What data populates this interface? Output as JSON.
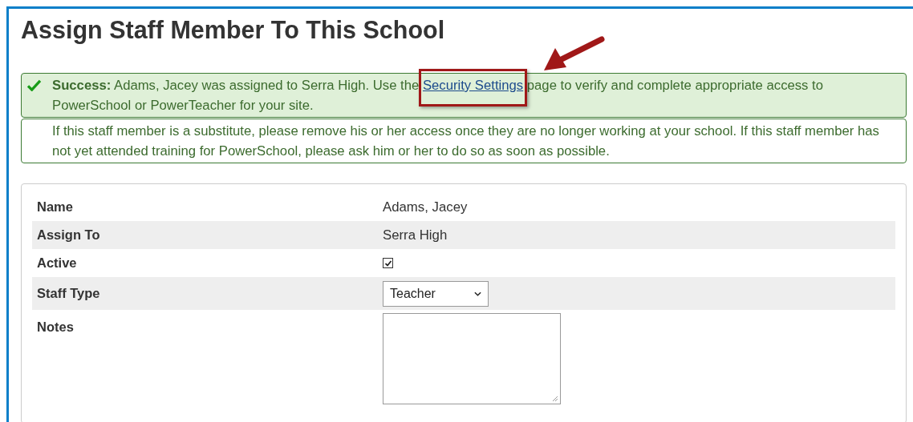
{
  "title": "Assign Staff Member To This School",
  "success": {
    "before": "**Success:** Adams, Jacey was assigned to Serra High. Use the",
    "link": "Security Settings",
    "after": "page to verify and complete appropriate access to PowerSchool or PowerTeacher for your site."
  },
  "notice": "If this staff member is a substitute, please remove his or her access once they are no longer working at your school. If this staff member has not yet attended training for PowerSchool, please ask him or her to do so as soon as possible.",
  "fields": [
    {
      "kind": "text",
      "label": "Name",
      "value": "Adams, Jacey"
    },
    {
      "kind": "text",
      "label": "Assign To",
      "value": "Serra High"
    },
    {
      "kind": "checkbox",
      "label": "Active",
      "checked": true
    },
    {
      "kind": "select",
      "label": "Staff Type",
      "value": "Teacher"
    },
    {
      "kind": "textarea",
      "label": "Notes"
    }
  ]
}
